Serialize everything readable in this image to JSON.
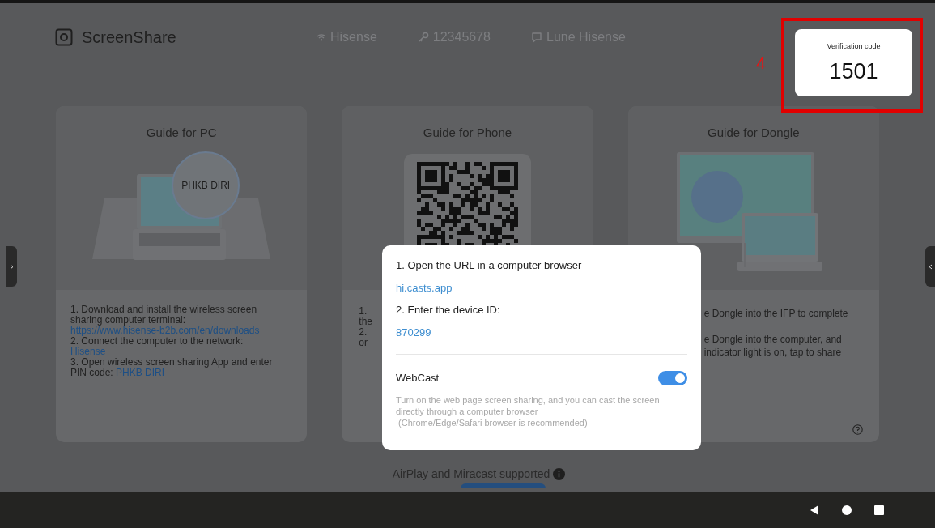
{
  "app": {
    "title": "ScreenShare"
  },
  "status": [
    {
      "kind": "wifi",
      "text": "Hisense"
    },
    {
      "kind": "key",
      "text": "12345678"
    },
    {
      "kind": "device",
      "text": "Lune Hisense"
    }
  ],
  "verification": {
    "label": "Verification code",
    "code": "1501"
  },
  "annotation": {
    "number": "4"
  },
  "pc_card": {
    "title": "Guide for PC",
    "bubble": "PHKB DIRI",
    "steps": [
      {
        "text": "1. Download and install the wireless screen sharing computer terminal:",
        "value": "https://www.hisense-b2b.com/en/downloads",
        "kind": "newline"
      },
      {
        "text": "2. Connect the computer to the network:",
        "value": "Hisense",
        "kind": "newline"
      },
      {
        "text": "3. Open wireless screen sharing App and enter PIN code:",
        "value": "PHKB DIRI",
        "kind": "inline"
      }
    ]
  },
  "phone_card": {
    "title": "Guide for Phone",
    "visible_lines": [
      "1.",
      "the",
      "2.",
      "or"
    ]
  },
  "dongle_card": {
    "title": "Guide for Dongle",
    "paragraphs": [
      [
        "e Dongle into the IFP to complete"
      ],
      [
        "e Dongle into the computer, and",
        "indicator light is on, tap to share"
      ]
    ]
  },
  "dialog": {
    "step1": "1. Open the URL in a computer browser",
    "url": "hi.casts.app",
    "step2": "2. Enter the device ID:",
    "device_id": "870299",
    "webcast": {
      "label": "WebCast",
      "on": true,
      "description": "Turn on the web page screen sharing, and you can cast the screen directly through a computer browser",
      "note": "(Chrome/Edge/Safari browser is recommended)"
    }
  },
  "footer": {
    "text": "AirPlay and Miracast supported"
  }
}
